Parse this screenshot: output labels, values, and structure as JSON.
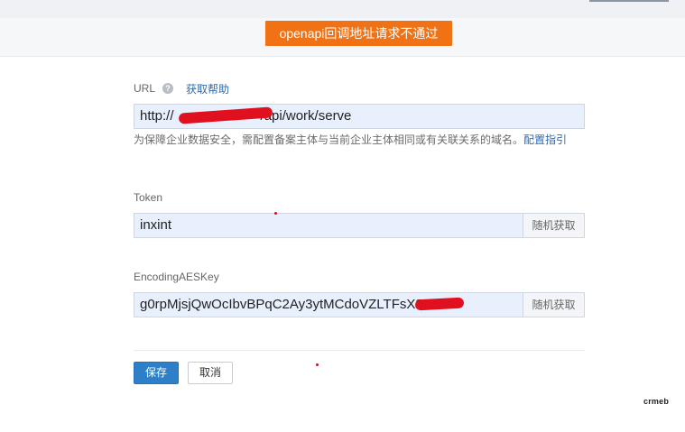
{
  "toast": {
    "message": "openapi回调地址请求不通过",
    "color": "#f07215"
  },
  "url_field": {
    "label": "URL",
    "help_link": "获取帮助",
    "value_prefix": "http://",
    "value_suffix": "/api/work/serve",
    "hint_text": "为保障企业数据安全，需配置备案主体与当前企业主体相同或有关联关系的域名。",
    "hint_link": "配置指引"
  },
  "token_field": {
    "label": "Token",
    "value": "inxint",
    "random_button": "随机获取"
  },
  "aes_field": {
    "label": "EncodingAESKey",
    "value": "g0rpMjsjQwOcIbvBPqC2Ay3ytMCdoVZLTFsX8",
    "random_button": "随机获取"
  },
  "actions": {
    "save": "保存",
    "cancel": "取消",
    "primary_color": "#2d7fc8"
  },
  "watermark": "crmeb"
}
